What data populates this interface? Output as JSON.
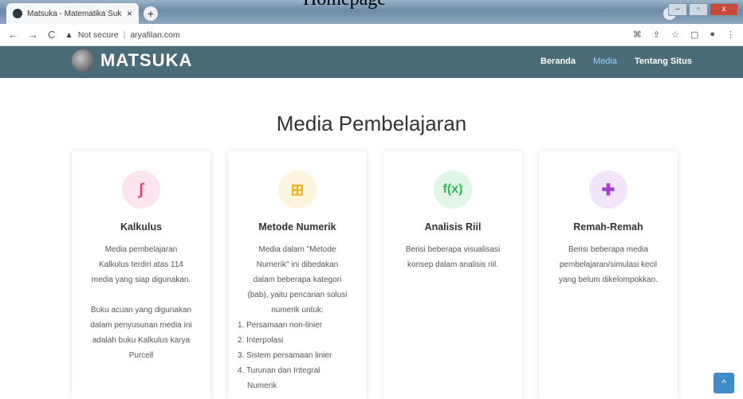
{
  "caption": "Homepage",
  "browser": {
    "tab_title": "Matsuka - Matematika Suka-Suk",
    "tab_close": "×",
    "new_tab": "+",
    "security": "Not secure",
    "url": "aryafilan.com",
    "window_controls": [
      "–",
      "▫",
      "x"
    ]
  },
  "site": {
    "logo_text": "MATSUKA",
    "nav": [
      "Beranda",
      "Media",
      "Tentang Situs"
    ]
  },
  "main": {
    "heading": "Media Pembelajaran",
    "cards": [
      {
        "title": "Kalkulus",
        "icon": "integral-icon",
        "icon_glyph": "∫",
        "icon_bg": "#fde4ee",
        "icon_color": "#e8417a",
        "desc_lines": [
          "Media pembelajaran",
          "Kalkulus terdiri atas 114",
          "media yang siap digunakan.",
          "",
          "Buku acuan yang digunakan",
          "dalam penyusunan media ini",
          "adalah buku Kalkulus karya",
          "Purcell"
        ]
      },
      {
        "title": "Metode Numerik",
        "icon": "calculator-icon",
        "icon_glyph": "⊞",
        "icon_bg": "#fff4dc",
        "icon_color": "#f0b323",
        "desc_lines": [
          "Media dalam \"Metode",
          "Numerik\" ini dibedakan",
          "dalam beberapa kategori",
          "(bab), yaitu pencarian solusi",
          "numerik untuk:"
        ],
        "list": [
          "1. Persamaan non-linier",
          "2. Interpolasi",
          "3. Sistem persamaan linier",
          "4. Turunan dan Integral",
          "Numerik"
        ]
      },
      {
        "title": "Analisis Riil",
        "icon": "function-icon",
        "icon_glyph": "f(x)",
        "icon_bg": "#e0f7e6",
        "icon_color": "#2dbb4e",
        "desc_lines": [
          "Berisi beberapa visualisasi",
          "konsep dalam analisis riil."
        ]
      },
      {
        "title": "Remah-Remah",
        "icon": "puzzle-icon",
        "icon_glyph": "✚",
        "icon_bg": "#f1e4fb",
        "icon_color": "#a63fd6",
        "desc_lines": [
          "Berisi beberapa media",
          "pembelajaran/simulasi kecil",
          "yang belum dikelompokkan."
        ]
      }
    ]
  },
  "scroll_top": "^"
}
